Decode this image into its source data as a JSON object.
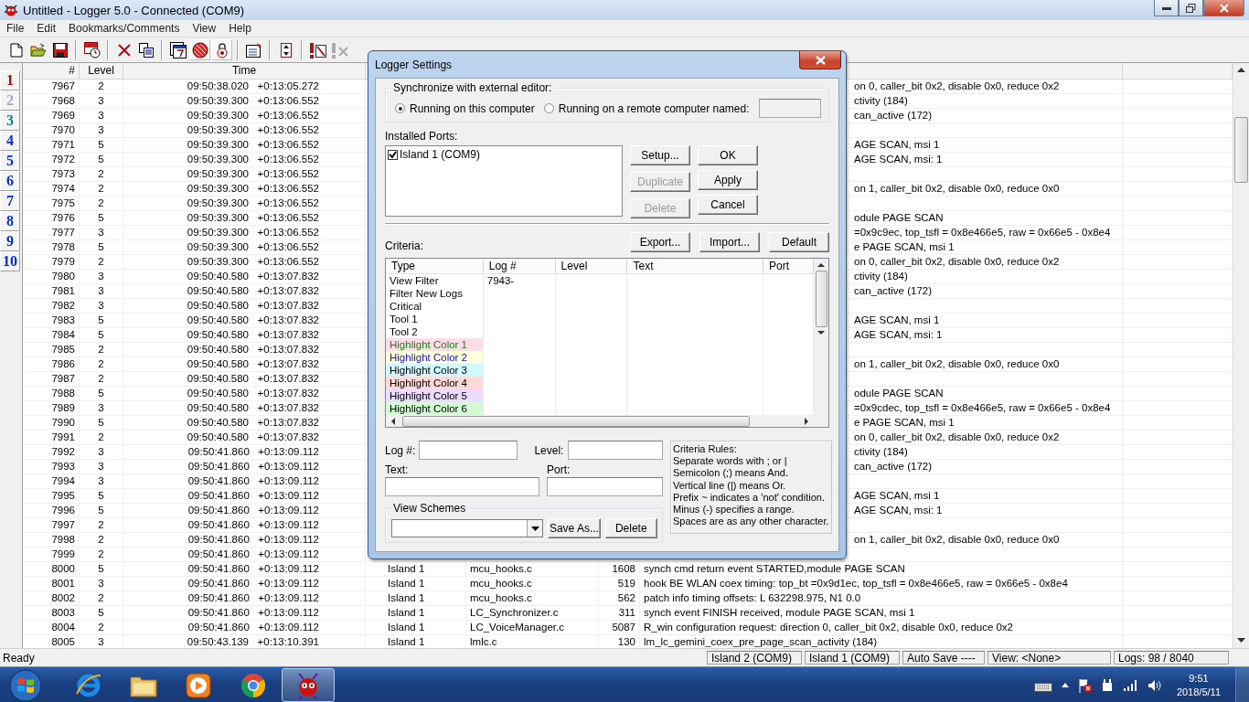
{
  "window": {
    "title": "Untitled - Logger 5.0 - Connected  (COM9)"
  },
  "menu": [
    "File",
    "Edit",
    "Bookmarks/Comments",
    "View",
    "Help"
  ],
  "toolbar_groups": [
    [
      {
        "kind": "new",
        "pressed": false,
        "disabled": false
      },
      {
        "kind": "open",
        "pressed": false,
        "disabled": false
      },
      {
        "kind": "save",
        "pressed": false,
        "disabled": false
      }
    ],
    [
      {
        "kind": "log-timer",
        "pressed": false,
        "disabled": false
      }
    ],
    [
      {
        "kind": "delete",
        "pressed": false,
        "disabled": false
      },
      {
        "kind": "copy",
        "pressed": false,
        "disabled": false
      }
    ],
    [
      {
        "kind": "calendar",
        "pressed": false,
        "disabled": false
      },
      {
        "kind": "record",
        "pressed": true,
        "disabled": false
      },
      {
        "kind": "lock",
        "pressed": true,
        "disabled": false
      }
    ],
    [
      {
        "kind": "properties",
        "pressed": false,
        "disabled": false
      }
    ],
    [
      {
        "kind": "up-down",
        "pressed": false,
        "disabled": false
      }
    ],
    [
      {
        "kind": "flag-note",
        "pressed": false,
        "disabled": false
      },
      {
        "kind": "clear-flags",
        "pressed": false,
        "disabled": true
      }
    ]
  ],
  "bookmarks": [
    {
      "label": "1",
      "color": "#8b1010"
    },
    {
      "label": "2",
      "color": "#a8a2c8"
    },
    {
      "label": "3",
      "color": "#1f6f8b"
    },
    {
      "label": "4",
      "color": "#0a2dc8"
    },
    {
      "label": "5",
      "color": "#0a2dc8"
    },
    {
      "label": "6",
      "color": "#0a2dc8"
    },
    {
      "label": "7",
      "color": "#0a2dc8"
    },
    {
      "label": "8",
      "color": "#0a2dc8"
    },
    {
      "label": "9",
      "color": "#0a2dc8"
    },
    {
      "label": "10",
      "color": "#0a2dc8"
    }
  ],
  "table": {
    "columns": [
      "#",
      "Level",
      "Time"
    ],
    "rows": [
      {
        "kind": "covered",
        "num": "7967",
        "log_level": "2",
        "time": "09:50:38.020   +0:13:05.272",
        "information": "on 0, caller_bit 0x2, disable 0x0, reduce 0x2"
      },
      {
        "kind": "covered",
        "num": "7968",
        "log_level": "3",
        "time": "09:50:39.300   +0:13:06.552",
        "information": "ctivity (184)"
      },
      {
        "kind": "covered",
        "num": "7969",
        "log_level": "3",
        "time": "09:50:39.300   +0:13:06.552",
        "information": "can_active (172)"
      },
      {
        "kind": "covered",
        "num": "7970",
        "log_level": "3",
        "time": "09:50:39.300   +0:13:06.552"
      },
      {
        "kind": "covered",
        "num": "7971",
        "log_level": "5",
        "time": "09:50:39.300   +0:13:06.552",
        "information": "AGE SCAN, msi 1"
      },
      {
        "kind": "covered",
        "num": "7972",
        "log_level": "5",
        "time": "09:50:39.300   +0:13:06.552",
        "information": "AGE SCAN, msi: 1"
      },
      {
        "kind": "covered",
        "num": "7973",
        "log_level": "2",
        "time": "09:50:39.300   +0:13:06.552"
      },
      {
        "kind": "covered",
        "num": "7974",
        "log_level": "2",
        "time": "09:50:39.300   +0:13:06.552",
        "information": "on 1, caller_bit 0x2, disable 0x0, reduce 0x0"
      },
      {
        "kind": "covered",
        "num": "7975",
        "log_level": "2",
        "time": "09:50:39.300   +0:13:06.552"
      },
      {
        "kind": "covered",
        "num": "7976",
        "log_level": "5",
        "time": "09:50:39.300   +0:13:06.552",
        "information": "odule PAGE SCAN"
      },
      {
        "kind": "covered",
        "num": "7977",
        "log_level": "3",
        "time": "09:50:39.300   +0:13:06.552",
        "information": "=0x9c9ec, top_tsfl = 0x8e466e5, raw = 0x66e5 - 0x8e4"
      },
      {
        "kind": "covered",
        "num": "7978",
        "log_level": "5",
        "time": "09:50:39.300   +0:13:06.552",
        "information": "e PAGE SCAN, msi 1"
      },
      {
        "kind": "covered",
        "num": "7979",
        "log_level": "2",
        "time": "09:50:39.300   +0:13:06.552",
        "information": "on 0, caller_bit 0x2, disable 0x0, reduce 0x2"
      },
      {
        "kind": "covered",
        "num": "7980",
        "log_level": "3",
        "time": "09:50:40.580   +0:13:07.832",
        "information": "ctivity (184)"
      },
      {
        "kind": "covered",
        "num": "7981",
        "log_level": "3",
        "time": "09:50:40.580   +0:13:07.832",
        "information": "can_active (172)"
      },
      {
        "kind": "covered",
        "num": "7982",
        "log_level": "3",
        "time": "09:50:40.580   +0:13:07.832"
      },
      {
        "kind": "covered",
        "num": "7983",
        "log_level": "5",
        "time": "09:50:40.580   +0:13:07.832",
        "information": "AGE SCAN, msi 1"
      },
      {
        "kind": "covered",
        "num": "7984",
        "log_level": "5",
        "time": "09:50:40.580   +0:13:07.832",
        "information": "AGE SCAN, msi: 1"
      },
      {
        "kind": "covered",
        "num": "7985",
        "log_level": "2",
        "time": "09:50:40.580   +0:13:07.832"
      },
      {
        "kind": "covered",
        "num": "7986",
        "log_level": "2",
        "time": "09:50:40.580   +0:13:07.832",
        "information": "on 1, caller_bit 0x2, disable 0x0, reduce 0x0"
      },
      {
        "kind": "covered",
        "num": "7987",
        "log_level": "2",
        "time": "09:50:40.580   +0:13:07.832"
      },
      {
        "kind": "covered",
        "num": "7988",
        "log_level": "5",
        "time": "09:50:40.580   +0:13:07.832",
        "information": "odule PAGE SCAN"
      },
      {
        "kind": "covered",
        "num": "7989",
        "log_level": "3",
        "time": "09:50:40.580   +0:13:07.832",
        "information": "=0x9cdec, top_tsfl = 0x8e466e5, raw = 0x66e5 - 0x8e4"
      },
      {
        "kind": "covered",
        "num": "7990",
        "log_level": "5",
        "time": "09:50:40.580   +0:13:07.832",
        "information": "e PAGE SCAN, msi 1"
      },
      {
        "kind": "covered",
        "num": "7991",
        "log_level": "2",
        "time": "09:50:40.580   +0:13:07.832",
        "information": "on 0, caller_bit 0x2, disable 0x0, reduce 0x2"
      },
      {
        "kind": "covered",
        "num": "7992",
        "log_level": "3",
        "time": "09:50:41.860   +0:13:09.112",
        "information": "ctivity (184)"
      },
      {
        "kind": "covered",
        "num": "7993",
        "log_level": "3",
        "time": "09:50:41.860   +0:13:09.112",
        "information": "can_active (172)"
      },
      {
        "kind": "covered",
        "num": "7994",
        "log_level": "3",
        "time": "09:50:41.860   +0:13:09.112"
      },
      {
        "kind": "covered",
        "num": "7995",
        "log_level": "5",
        "time": "09:50:41.860   +0:13:09.112",
        "information": "AGE SCAN, msi 1"
      },
      {
        "kind": "covered",
        "num": "7996",
        "log_level": "5",
        "time": "09:50:41.860   +0:13:09.112",
        "information": "AGE SCAN, msi: 1"
      },
      {
        "kind": "covered",
        "num": "7997",
        "log_level": "2",
        "time": "09:50:41.860   +0:13:09.112"
      },
      {
        "kind": "covered",
        "num": "7998",
        "log_level": "2",
        "time": "09:50:41.860   +0:13:09.112",
        "information": "on 1, caller_bit 0x2, disable 0x0, reduce 0x0"
      },
      {
        "kind": "covered",
        "num": "7999",
        "log_level": "2",
        "time": "09:50:41.860   +0:13:09.112"
      },
      {
        "kind": "full",
        "num": "8000",
        "log_level": "5",
        "time": "09:50:41.860   +0:13:09.112",
        "port": "Island 1",
        "file": "mcu_hooks.c",
        "line": "1608",
        "information": "synch cmd return event STARTED,module PAGE SCAN"
      },
      {
        "kind": "full",
        "num": "8001",
        "log_level": "3",
        "time": "09:50:41.860   +0:13:09.112",
        "port": "Island 1",
        "file": "mcu_hooks.c",
        "line": "519",
        "information": "hook BE WLAN coex timing: top_bt =0x9d1ec, top_tsfl = 0x8e466e5, raw = 0x66e5 - 0x8e4"
      },
      {
        "kind": "full",
        "num": "8002",
        "log_level": "2",
        "time": "09:50:41.860   +0:13:09.112",
        "port": "Island 1",
        "file": "mcu_hooks.c",
        "line": "562",
        "information": "patch info timing offsets: L 632298.975, N1 0.0"
      },
      {
        "kind": "full",
        "num": "8003",
        "log_level": "5",
        "time": "09:50:41.860   +0:13:09.112",
        "port": "Island 1",
        "file": "LC_Synchronizer.c",
        "line": "311",
        "information": "synch event FINISH received, module PAGE SCAN, msi 1"
      },
      {
        "kind": "full",
        "num": "8004",
        "log_level": "2",
        "time": "09:50:41.860   +0:13:09.112",
        "port": "Island 1",
        "file": "LC_VoiceManager.c",
        "line": "5087",
        "information": "R_win configuration request: direction 0, caller_bit 0x2, disable 0x0, reduce 0x2"
      },
      {
        "kind": "full",
        "num": "8005",
        "log_level": "3",
        "time": "09:50:43.139   +0:13:10.391",
        "port": "Island 1",
        "file": "lmlc.c",
        "line": "130",
        "information": "lm_lc_gemini_coex_pre_page_scan_activity (184)"
      }
    ]
  },
  "dialog": {
    "title": "Logger Settings",
    "sync": {
      "legend": "Synchronize with external editor:",
      "options": [
        {
          "label": "Running on this computer",
          "selected": true
        },
        {
          "label": "Running on a remote computer named:",
          "selected": false
        }
      ]
    },
    "ports_label": "Installed Ports:",
    "ports": [
      {
        "label": "Island 1 (COM9)",
        "checked": true
      }
    ],
    "port_buttons": [
      {
        "label": "Setup...",
        "disabled": false
      },
      {
        "label": "Duplicate",
        "disabled": true
      },
      {
        "label": "Delete",
        "disabled": true
      }
    ],
    "main_buttons": [
      "OK",
      "Apply",
      "Cancel"
    ],
    "criteria_label": "Criteria:",
    "criteria_buttons": [
      "Export...",
      "Import...",
      "Default"
    ],
    "criteria_columns": [
      "Type",
      "Log #",
      "Level",
      "Text",
      "Port"
    ],
    "criteria_rows": [
      {
        "type": "View Filter",
        "log": "7943-"
      },
      {
        "type": "Filter New Logs"
      },
      {
        "type": "Critical"
      },
      {
        "type": "Tool 1"
      },
      {
        "type": "Tool 2"
      },
      {
        "type": "Highlight Color 1",
        "color": "#1a7f1a",
        "swatch": {
          "color": "#ffdde6"
        }
      },
      {
        "type": "Highlight Color 2",
        "color": "#1010e0",
        "swatch": {
          "color": "#ffffe0"
        }
      },
      {
        "type": "Highlight Color 3",
        "color": "#000000",
        "swatch": {
          "color": "#d2f8ff"
        }
      },
      {
        "type": "Highlight Color 4",
        "color": "#000000",
        "swatch": {
          "color": "#ffd8d8"
        }
      },
      {
        "type": "Highlight Color 5",
        "color": "#000000",
        "swatch": {
          "color": "#ecdcff"
        }
      },
      {
        "type": "Highlight Color 6",
        "color": "#000000",
        "swatch": {
          "color": "#d4fcd4"
        }
      }
    ],
    "fields": {
      "log": "Log #:",
      "level": "Level:",
      "text": "Text:",
      "port": "Port:"
    },
    "schemes": {
      "legend": "View Schemes",
      "buttons": [
        "Save As...",
        "Delete"
      ]
    },
    "rules": [
      "Criteria Rules:",
      "Separate words with ; or |",
      "Semicolon (;) means And.",
      "Vertical line (|) means Or.",
      "Prefix ~ indicates a 'not' condition.",
      "Minus (-)  specifies a range.",
      "Spaces are as any other character."
    ]
  },
  "status_bar": {
    "message": "Ready",
    "panes": [
      "Island 2 (COM9)",
      "Island 1 (COM9)",
      "Auto Save ----",
      "View: <None>",
      "Logs: 98 / 8040"
    ]
  },
  "taskbar": {
    "apps": [
      {
        "kind": "browser",
        "selected": false
      },
      {
        "kind": "folder",
        "selected": false
      },
      {
        "kind": "media",
        "selected": false
      },
      {
        "kind": "chrome",
        "selected": false
      },
      {
        "kind": "logger",
        "selected": true
      }
    ],
    "clock": {
      "time": "9:51",
      "date": "2018/5/11"
    }
  }
}
